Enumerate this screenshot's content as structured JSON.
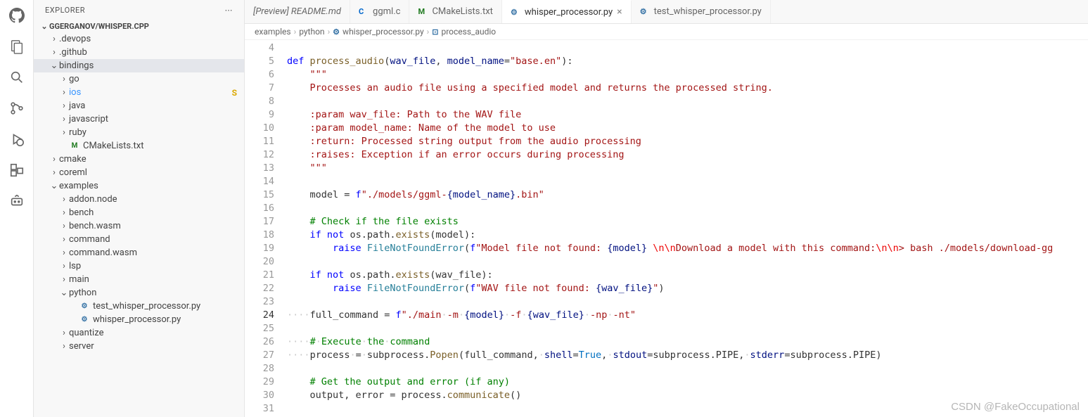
{
  "sidebar": {
    "title": "EXPLORER",
    "repo": "GGERGANOV/WHISPER.CPP",
    "tree": [
      {
        "label": ".devops",
        "kind": "folder",
        "expanded": false,
        "indent": 1
      },
      {
        "label": ".github",
        "kind": "folder",
        "expanded": false,
        "indent": 1
      },
      {
        "label": "bindings",
        "kind": "folder",
        "expanded": true,
        "indent": 1,
        "selected": true
      },
      {
        "label": "go",
        "kind": "folder",
        "expanded": false,
        "indent": 2
      },
      {
        "label": "ios",
        "kind": "folder",
        "expanded": false,
        "indent": 2,
        "status": "S",
        "color": "#3794ff"
      },
      {
        "label": "java",
        "kind": "folder",
        "expanded": false,
        "indent": 2
      },
      {
        "label": "javascript",
        "kind": "folder",
        "expanded": false,
        "indent": 2
      },
      {
        "label": "ruby",
        "kind": "folder",
        "expanded": false,
        "indent": 2
      },
      {
        "label": "CMakeLists.txt",
        "kind": "file",
        "icon": "M",
        "iconclass": "cmake",
        "indent": 2
      },
      {
        "label": "cmake",
        "kind": "folder",
        "expanded": false,
        "indent": 1
      },
      {
        "label": "coreml",
        "kind": "folder",
        "expanded": false,
        "indent": 1
      },
      {
        "label": "examples",
        "kind": "folder",
        "expanded": true,
        "indent": 1
      },
      {
        "label": "addon.node",
        "kind": "folder",
        "expanded": false,
        "indent": 2
      },
      {
        "label": "bench",
        "kind": "folder",
        "expanded": false,
        "indent": 2
      },
      {
        "label": "bench.wasm",
        "kind": "folder",
        "expanded": false,
        "indent": 2
      },
      {
        "label": "command",
        "kind": "folder",
        "expanded": false,
        "indent": 2
      },
      {
        "label": "command.wasm",
        "kind": "folder",
        "expanded": false,
        "indent": 2
      },
      {
        "label": "lsp",
        "kind": "folder",
        "expanded": false,
        "indent": 2
      },
      {
        "label": "main",
        "kind": "folder",
        "expanded": false,
        "indent": 2
      },
      {
        "label": "python",
        "kind": "folder",
        "expanded": true,
        "indent": 2
      },
      {
        "label": "test_whisper_processor.py",
        "kind": "file",
        "icon": "⚙",
        "iconclass": "py",
        "indent": 3
      },
      {
        "label": "whisper_processor.py",
        "kind": "file",
        "icon": "⚙",
        "iconclass": "py",
        "indent": 3
      },
      {
        "label": "quantize",
        "kind": "folder",
        "expanded": false,
        "indent": 2
      },
      {
        "label": "server",
        "kind": "folder",
        "expanded": false,
        "indent": 2
      }
    ]
  },
  "tabs": [
    {
      "label": "[Preview] README.md",
      "icon": "",
      "active": false,
      "preview": true
    },
    {
      "label": "ggml.c",
      "icon": "C",
      "iconcolor": "#0066cc",
      "active": false
    },
    {
      "label": "CMakeLists.txt",
      "icon": "M",
      "iconcolor": "#1f7a1f",
      "active": false
    },
    {
      "label": "whisper_processor.py",
      "icon": "⚙",
      "iconcolor": "#3572A5",
      "active": true,
      "close": true
    },
    {
      "label": "test_whisper_processor.py",
      "icon": "⚙",
      "iconcolor": "#3572A5",
      "active": false
    }
  ],
  "breadcrumbs": [
    "examples",
    "python",
    "whisper_processor.py",
    "process_audio"
  ],
  "bc_icons": [
    "",
    "",
    "⚙",
    "⊡"
  ],
  "gutter_start": 4,
  "gutter_end": 31,
  "current_line": 24,
  "code": {
    "l4": "",
    "l5_def": "def ",
    "l5_fn": "process_audio",
    "l5_sig1": "(",
    "l5_p1": "wav_file",
    "l5_c1": ", ",
    "l5_p2": "model_name",
    "l5_eq": "=",
    "l5_str": "\"base.en\"",
    "l5_sig2": "):",
    "l6_doc": "    \"\"\"",
    "l7_doc": "    Processes an audio file using a specified model and returns the processed string.",
    "l8": "",
    "l9_doc": "    :param wav_file: Path to the WAV file",
    "l10_doc": "    :param model_name: Name of the model to use",
    "l11_doc": "    :return: Processed string output from the audio processing",
    "l12_doc": "    :raises: Exception if an error occurs during processing",
    "l13_doc": "    \"\"\"",
    "l14": "",
    "l15_a": "    model = ",
    "l15_f": "f",
    "l15_s1": "\"./models/ggml-",
    "l15_br1": "{",
    "l15_v1": "model_name",
    "l15_br2": "}",
    "l15_s2": ".bin\"",
    "l16": "",
    "l17_cmt": "    # Check if the file exists",
    "l18_a": "    ",
    "l18_if": "if",
    "l18_b": " ",
    "l18_not": "not",
    "l18_c": " os.path.",
    "l18_fn": "exists",
    "l18_d": "(model):",
    "l19_a": "        ",
    "l19_raise": "raise",
    "l19_b": " ",
    "l19_cls": "FileNotFoundError",
    "l19_c": "(",
    "l19_f": "f",
    "l19_s1": "\"Model file not found: ",
    "l19_br1": "{",
    "l19_v1": "model",
    "l19_br2": "}",
    "l19_s2": " ",
    "l19_esc1": "\\n\\n",
    "l19_s3": "Download a model with this command:",
    "l19_esc2": "\\n\\n",
    "l19_s4": "> bash ./models/download-gg",
    "l20": "",
    "l21_a": "    ",
    "l21_if": "if",
    "l21_b": " ",
    "l21_not": "not",
    "l21_c": " os.path.",
    "l21_fn": "exists",
    "l21_d": "(wav_file):",
    "l22_a": "        ",
    "l22_raise": "raise",
    "l22_b": " ",
    "l22_cls": "FileNotFoundError",
    "l22_c": "(",
    "l22_f": "f",
    "l22_s1": "\"WAV file not found: ",
    "l22_br1": "{",
    "l22_v1": "wav_file",
    "l22_br2": "}",
    "l22_s2": "\"",
    "l22_d": ")",
    "l23": "",
    "l24_ws": "····",
    "l24_a": "full_command = ",
    "l24_f": "f",
    "l24_s1": "\"./main·-m·",
    "l24_br1": "{",
    "l24_v1": "model",
    "l24_br2": "}",
    "l24_s2": "·-f·",
    "l24_br3": "{",
    "l24_v2": "wav_file",
    "l24_br4": "}",
    "l24_s3": "·-np·-nt\"",
    "l25": "",
    "l26_ws": "····",
    "l26_cmt": "#·Execute·the·command",
    "l27_ws": "····",
    "l27_a": "process·=·subprocess.",
    "l27_fn": "Popen",
    "l27_b": "(full_command,·",
    "l27_p1": "shell",
    "l27_eq1": "=",
    "l27_c1": "True",
    "l27_cm1": ",·",
    "l27_p2": "stdout",
    "l27_eq2": "=",
    "l27_v2": "subprocess.PIPE",
    "l27_cm2": ",·",
    "l27_p3": "stderr",
    "l27_eq3": "=",
    "l27_v3": "subprocess.PIPE",
    "l27_d": ")",
    "l28": "",
    "l29_cmt": "    # Get the output and error (if any)",
    "l30_a": "    output, error = process.",
    "l30_fn": "communicate",
    "l30_b": "()",
    "l31": ""
  },
  "watermark": "CSDN @FakeOccupational"
}
